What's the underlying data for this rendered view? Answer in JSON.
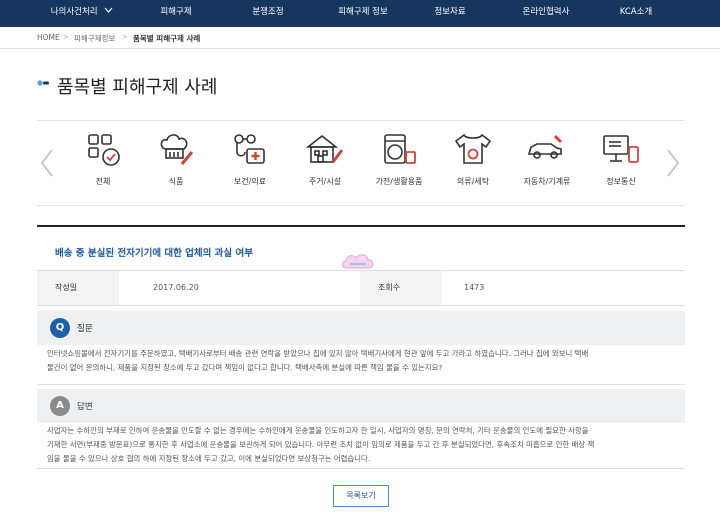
{
  "topnav": {
    "items": [
      "나의사건처리",
      "피해구제",
      "분쟁조정",
      "피해구제 정보",
      "정보자료",
      "온라인협력사",
      "KCA소개"
    ]
  },
  "breadcrumb": {
    "home": "HOME",
    "parent": "피해구제정보",
    "current": "품목별 피해구제 사례"
  },
  "page": {
    "title": "품목별 피해구제 사례"
  },
  "categories": [
    {
      "label": "전체",
      "icon": "grid-check-icon"
    },
    {
      "label": "식품",
      "icon": "chef-hat-icon"
    },
    {
      "label": "보건/의료",
      "icon": "medical-kit-icon"
    },
    {
      "label": "주거/시설",
      "icon": "house-icon"
    },
    {
      "label": "가전/생활용품",
      "icon": "washing-machine-icon"
    },
    {
      "label": "의류/세탁",
      "icon": "tshirt-icon"
    },
    {
      "label": "자동차/기계류",
      "icon": "car-wrench-icon"
    },
    {
      "label": "정보통신",
      "icon": "monitor-phone-icon"
    }
  ],
  "post": {
    "title": "배송 중 분실된 전자기기에 대한 업체의 과실 여부",
    "date_label": "작성일",
    "date_value": "2017.06.20",
    "views_label": "조회수",
    "views_value": "1473"
  },
  "question": {
    "badge": "Q",
    "label": "질문",
    "line1": "인터넷쇼핑몰에서 전자기기를 주문하였고, 택배기사로부터 배송 관련 연락을 받았으나 집에 있지 않아 택배기사에게 현관 앞에 두고 가라고 하였습니다. 그러나 집에 와보니 택배",
    "line2": "물건이 없어 문의하니, 제품을 지정된 장소에 두고 갔다며 책임이 없다고 합니다. 택배사측에 분실에 따른 책임 물을 수 있는지요?"
  },
  "answer": {
    "badge": "A",
    "label": "답변",
    "line1": "사업자는 수하인의 부재로 인하여 운송물을 인도할 수 없는 경우에는 수하인에게 운송물을 인도하고자 한 일시, 사업자의 명칭, 문의 연락처, 기타 운송물의 인도에 필요한 사항을",
    "line2": "기재한 서면(부재중 방문표)으로 통지한 후 사업소에 운송물을 보관하게 되어 있습니다. 아무런 조치 없이 임의로 제품을 두고 간 후 분실되었다면, 후속조치 미흡으로 인한 배상 책",
    "line3": "임을 물을 수 있으나 상호 협의 하에 지정된 장소에 두고 갔고, 이에 분실되었다면 보상청구는 어렵습니다."
  },
  "buttons": {
    "list": "목록보기"
  },
  "colors": {
    "nav_bg": "#16355f",
    "accent_blue": "#1e5aa0",
    "badge_blue": "#1f5fa8",
    "badge_gray": "#8a8a8a"
  }
}
